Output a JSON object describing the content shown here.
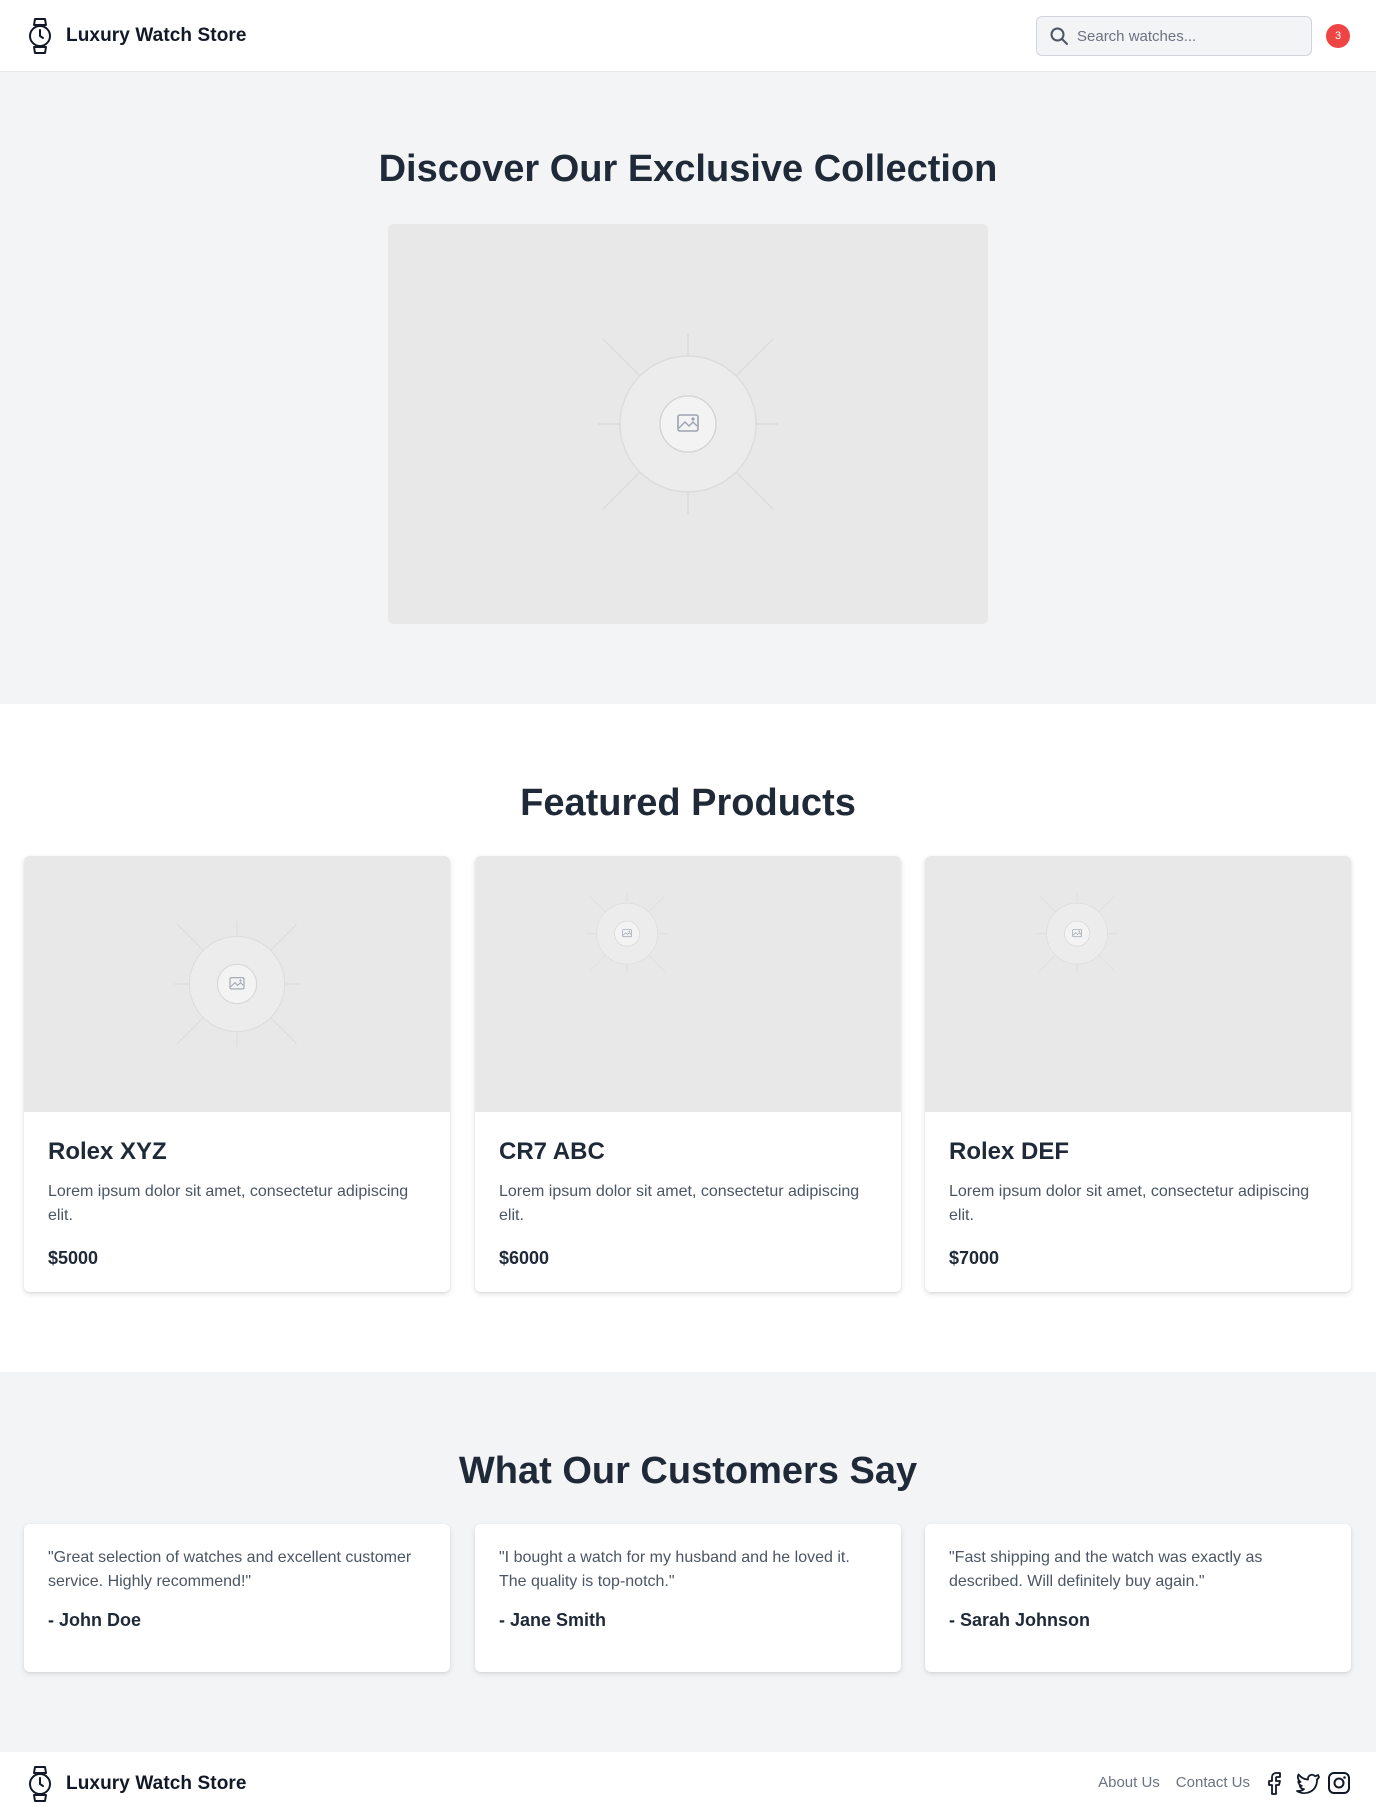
{
  "header": {
    "brand": "Luxury Watch Store",
    "brand_icon": "watch-icon",
    "search_placeholder": "Search watches...",
    "search_icon": "search-icon",
    "cart_icon": "cart-icon",
    "cart_count": "3"
  },
  "hero": {
    "title": "Discover Our Exclusive Collection",
    "image_icon": "image-placeholder-icon"
  },
  "featured": {
    "title": "Featured Products",
    "products": [
      {
        "name": "Rolex XYZ",
        "description": "Lorem ipsum dolor sit amet, consectetur adipiscing elit.",
        "price": "$5000"
      },
      {
        "name": "CR7 ABC",
        "description": "Lorem ipsum dolor sit amet, consectetur adipiscing elit.",
        "price": "$6000"
      },
      {
        "name": "Rolex DEF",
        "description": "Lorem ipsum dolor sit amet, consectetur adipiscing elit.",
        "price": "$7000"
      }
    ]
  },
  "testimonials": {
    "title": "What Our Customers Say",
    "items": [
      {
        "quote": "\"Great selection of watches and excellent customer service. Highly recommend!\"",
        "author": "- John Doe"
      },
      {
        "quote": "\"I bought a watch for my husband and he loved it. The quality is top-notch.\"",
        "author": "- Jane Smith"
      },
      {
        "quote": "\"Fast shipping and the watch was exactly as described. Will definitely buy again.\"",
        "author": "- Sarah Johnson"
      }
    ]
  },
  "footer": {
    "brand": "Luxury Watch Store",
    "links": [
      "About Us",
      "Contact Us"
    ],
    "social_icons": [
      "facebook-icon",
      "twitter-icon",
      "instagram-icon"
    ]
  },
  "colors": {
    "badge": "#ef4444",
    "section_bg": "#f3f4f6",
    "heading": "#1f2937",
    "body_text": "#4b5563"
  }
}
